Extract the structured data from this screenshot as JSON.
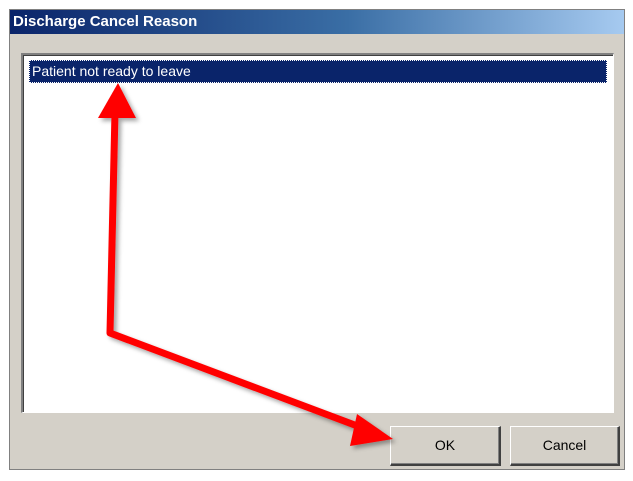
{
  "dialog": {
    "title": "Discharge Cancel Reason"
  },
  "reason_list": {
    "items": [
      {
        "label": "Patient not ready to leave",
        "selected": true
      }
    ]
  },
  "buttons": {
    "ok_label": "OK",
    "cancel_label": "Cancel"
  },
  "colors": {
    "title_bar_start": "#0a246a",
    "title_bar_end": "#a6caf0",
    "selection": "#0a246a",
    "dialog_face": "#d4d0c8",
    "annotation_arrow": "#ff0000"
  },
  "annotation": {
    "arrow_icon": "red-arrow-icon"
  }
}
